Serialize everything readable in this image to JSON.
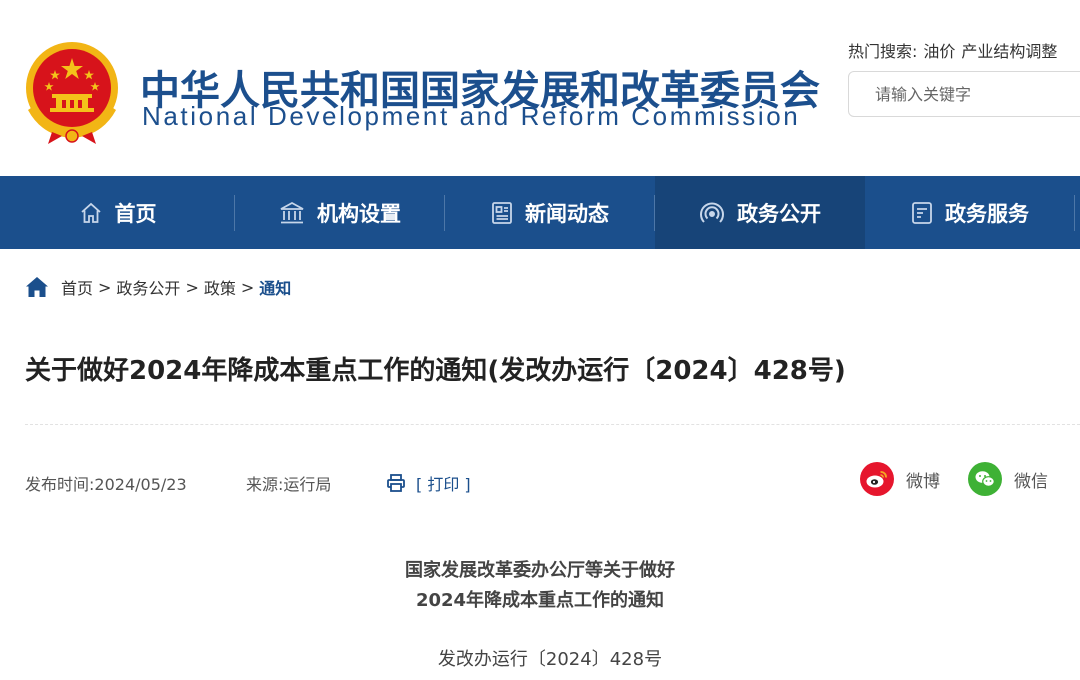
{
  "site": {
    "title_cn": "中华人民共和国国家发展和改革委员会",
    "title_en": "National Development and Reform Commission"
  },
  "hot_search": {
    "label": "热门搜索:",
    "terms": [
      "油价",
      "产业结构调整"
    ]
  },
  "search": {
    "placeholder": "请输入关键字"
  },
  "nav": {
    "items": [
      {
        "label": "首页",
        "icon": "home-outline-icon"
      },
      {
        "label": "机构设置",
        "icon": "institution-icon"
      },
      {
        "label": "新闻动态",
        "icon": "newspaper-icon"
      },
      {
        "label": "政务公开",
        "icon": "broadcast-icon",
        "active": true
      },
      {
        "label": "政务服务",
        "icon": "document-service-icon"
      }
    ]
  },
  "breadcrumb": {
    "items": [
      "首页",
      "政务公开",
      "政策",
      "通知"
    ],
    "separator": ">"
  },
  "article": {
    "title": "关于做好2024年降成本重点工作的通知(发改办运行〔2024〕428号)",
    "publish_label": "发布时间:",
    "publish_date": "2024/05/23",
    "source_label": "来源:",
    "source": "运行局",
    "print_label": "[ 打印 ]",
    "share": {
      "weibo": "微博",
      "wechat": "微信"
    },
    "doc_heading_line1": "国家发展改革委办公厅等关于做好",
    "doc_heading_line2": "2024年降成本重点工作的通知",
    "doc_number": "发改办运行〔2024〕428号"
  },
  "colors": {
    "brand_blue": "#1b4f8c",
    "nav_active": "#174478",
    "weibo_red": "#e6162d",
    "wechat_green": "#3eb135"
  }
}
